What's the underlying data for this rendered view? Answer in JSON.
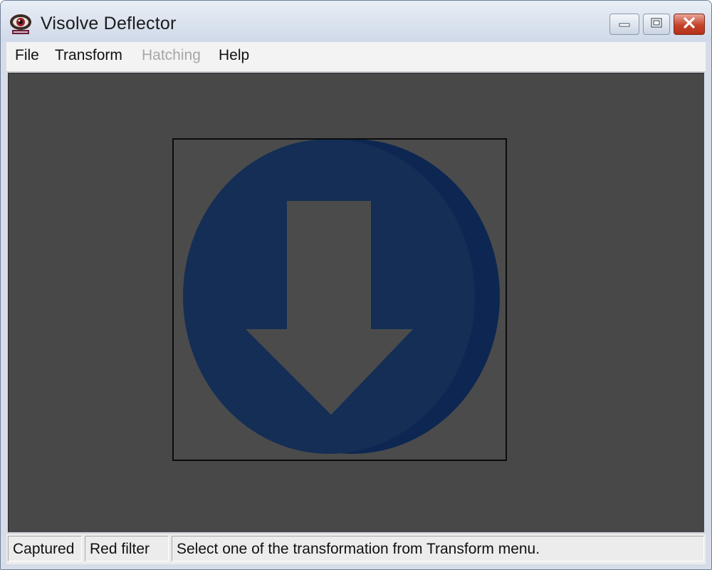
{
  "window": {
    "title": "Visolve Deflector",
    "controls": {
      "minimize_icon": "minimize-icon",
      "maximize_icon": "maximize-icon",
      "close_icon": "close-icon"
    }
  },
  "menu": {
    "items": [
      {
        "label": "File",
        "enabled": true
      },
      {
        "label": "Transform",
        "enabled": true
      },
      {
        "label": "Hatching",
        "enabled": false
      },
      {
        "label": "Help",
        "enabled": true
      }
    ]
  },
  "canvas": {
    "image": {
      "icon": "download-arrow-icon",
      "circle_color": "#142e56",
      "arrow_color": "#4b4b4b"
    }
  },
  "statusbar": {
    "cells": [
      {
        "text": "Captured"
      },
      {
        "text": "Red filter"
      },
      {
        "text": "Select one of the transformation from Transform menu."
      }
    ]
  },
  "colors": {
    "canvas_bg": "#484848",
    "close_button": "#c4432b",
    "disabled_text": "#a7a7a7"
  }
}
